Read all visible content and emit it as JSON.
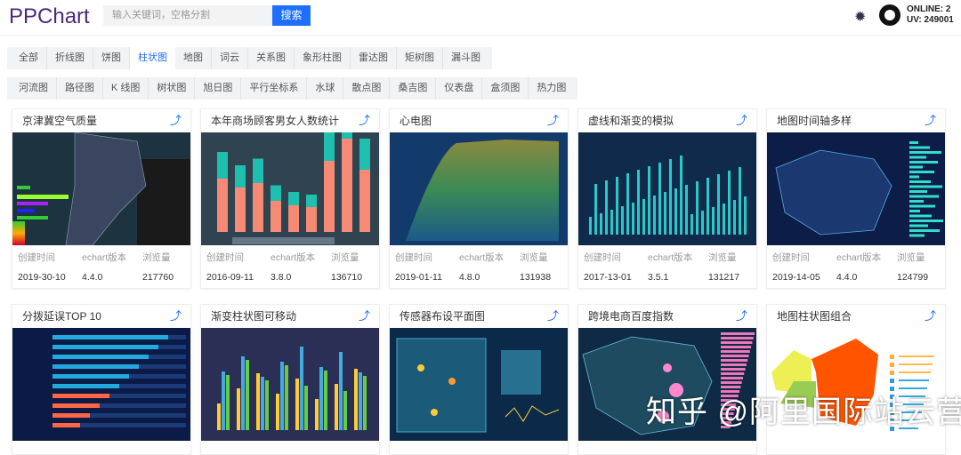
{
  "header": {
    "logo": "PPChart",
    "search_placeholder": "输入关键词，空格分割",
    "search_button": "搜索",
    "online": "ONLINE: 2",
    "uv": "UV: 249001"
  },
  "filters_row1": [
    "全部",
    "折线图",
    "饼图",
    "柱状图",
    "地图",
    "词云",
    "关系图",
    "象形柱图",
    "雷达图",
    "矩树图",
    "漏斗图"
  ],
  "filters_row2": [
    "河流图",
    "路径图",
    "K 线图",
    "树状图",
    "旭日图",
    "平行坐标系",
    "水球",
    "散点图",
    "桑吉图",
    "仪表盘",
    "盒须图",
    "热力图"
  ],
  "active_filter": "柱状图",
  "meta_labels": {
    "created": "创建时间",
    "version": "echart版本",
    "views": "浏览量"
  },
  "cards": [
    {
      "title": "京津冀空气质量",
      "created": "2019-30-10",
      "version": "4.4.0",
      "views": "217760"
    },
    {
      "title": "本年商场顾客男女人数统计",
      "created": "2016-09-11",
      "version": "3.8.0",
      "views": "136710"
    },
    {
      "title": "心电图",
      "created": "2019-01-11",
      "version": "4.8.0",
      "views": "131938"
    },
    {
      "title": "虚线和渐变的模拟",
      "created": "2017-13-01",
      "version": "3.5.1",
      "views": "131217"
    },
    {
      "title": "地图时间轴多样",
      "created": "2019-14-05",
      "version": "4.4.0",
      "views": "124799"
    },
    {
      "title": "分拨延误TOP 10"
    },
    {
      "title": "渐变柱状图可移动"
    },
    {
      "title": "传感器布设平面图"
    },
    {
      "title": "跨境电商百度指数"
    },
    {
      "title": "地图柱状图组合"
    }
  ],
  "watermark": "知乎 @阿里国际站云营"
}
